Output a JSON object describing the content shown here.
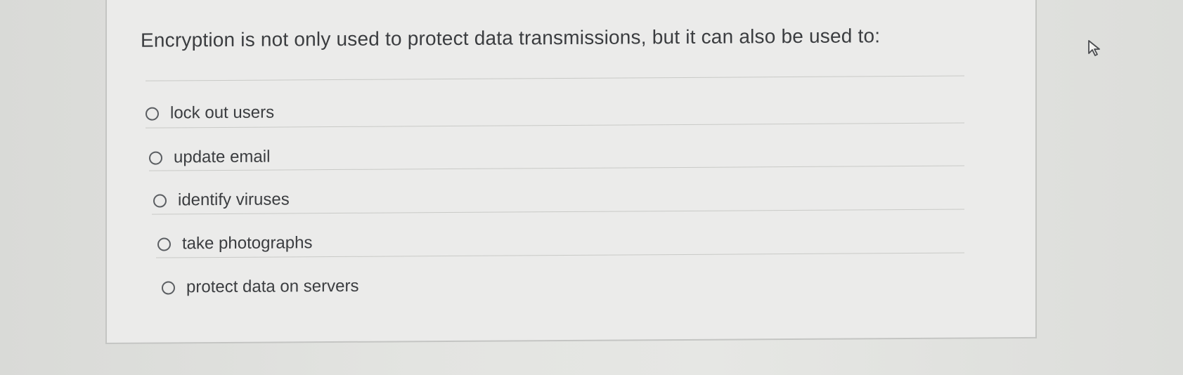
{
  "question": {
    "text": "Encryption is not only used to protect data transmissions, but it can also be used to:"
  },
  "options": [
    {
      "label": "lock out users",
      "selected": false
    },
    {
      "label": "update email",
      "selected": false
    },
    {
      "label": "identify viruses",
      "selected": false
    },
    {
      "label": "take photographs",
      "selected": false
    },
    {
      "label": "protect data on servers",
      "selected": false
    }
  ],
  "cursor": {
    "icon": "mouse-pointer-icon"
  }
}
